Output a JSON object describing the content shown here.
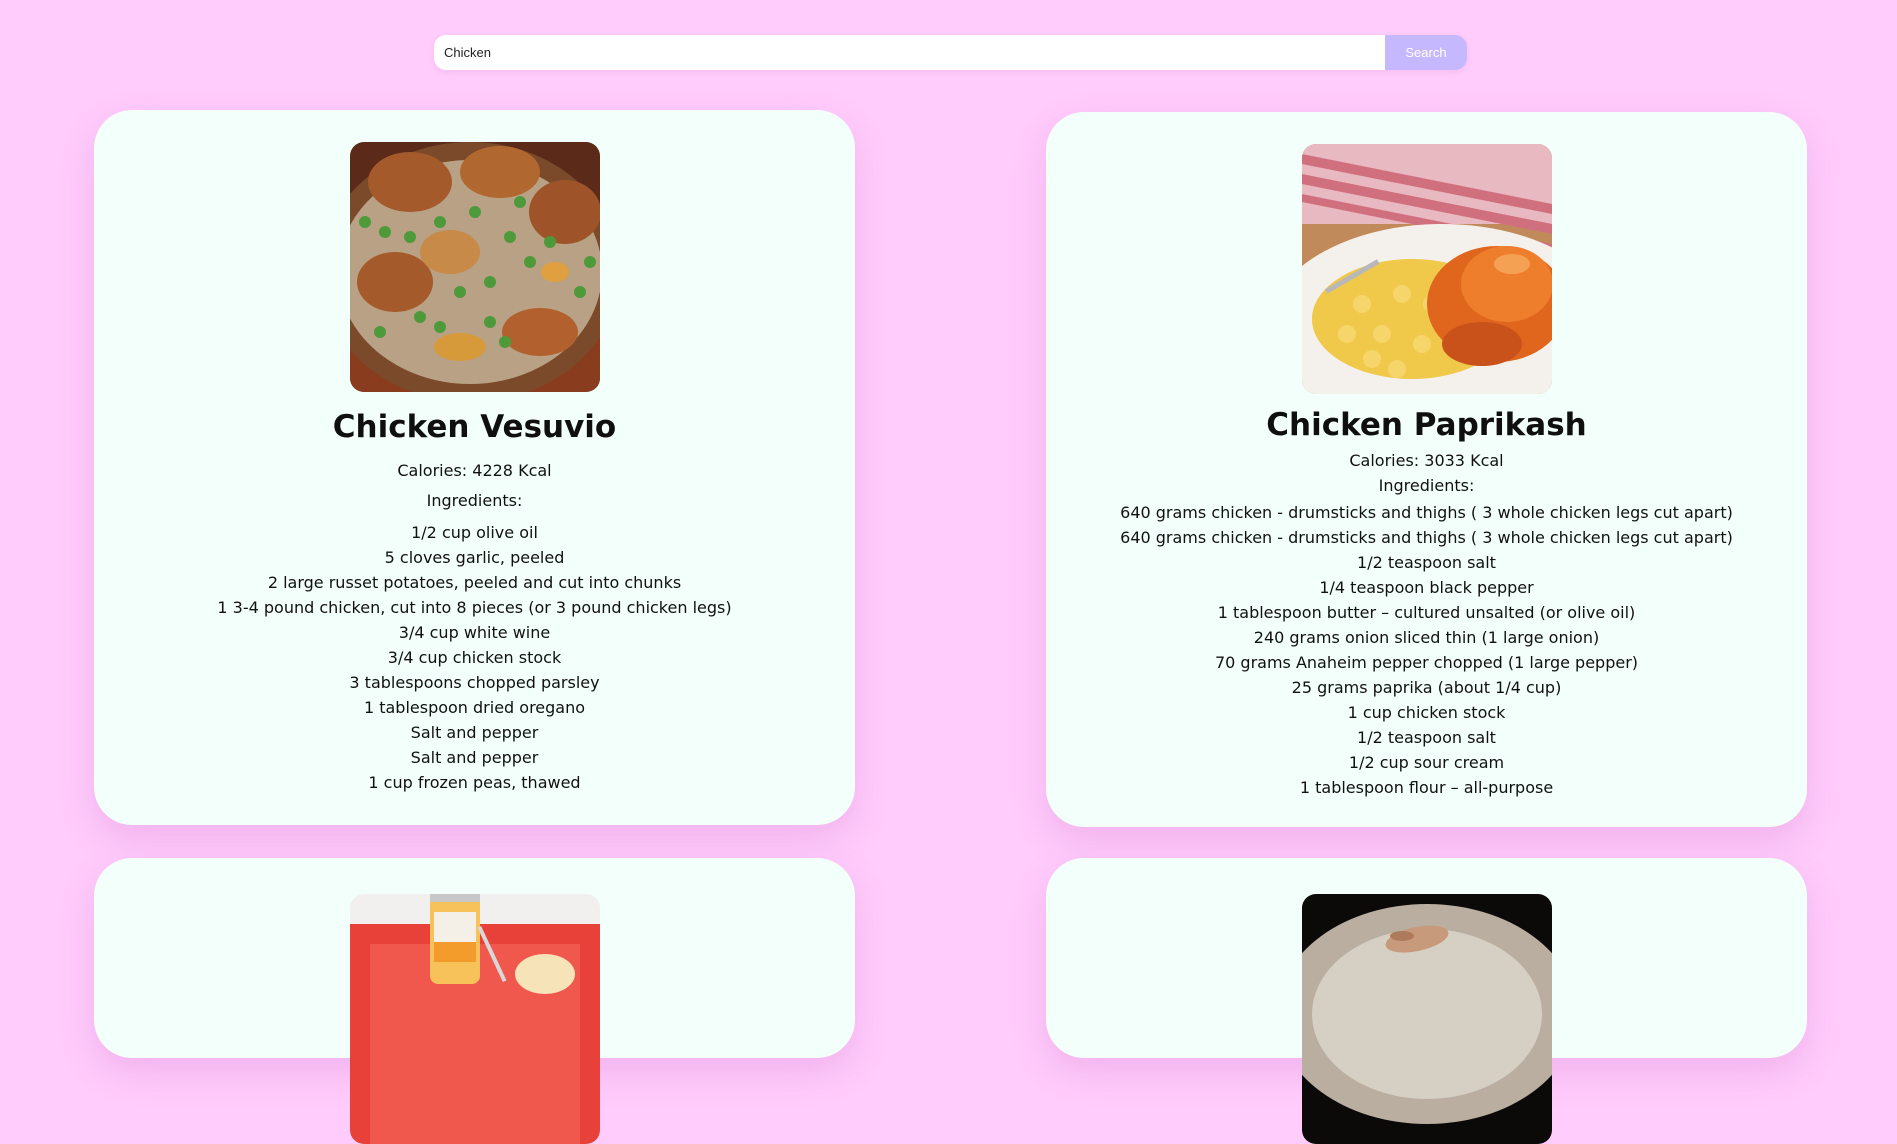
{
  "search": {
    "value": "Chicken",
    "button_label": "Search"
  },
  "recipes": [
    {
      "title": "Chicken Vesuvio",
      "calories": "Calories: 4228 Kcal",
      "ingredients_label": "Ingredients:",
      "ingredients": [
        "1/2 cup olive oil",
        "5 cloves garlic, peeled",
        "2 large russet potatoes, peeled and cut into chunks",
        "1 3-4 pound chicken, cut into 8 pieces (or 3 pound chicken legs)",
        "3/4 cup white wine",
        "3/4 cup chicken stock",
        "3 tablespoons chopped parsley",
        "1 tablespoon dried oregano",
        "Salt and pepper",
        "Salt and pepper",
        "1 cup frozen peas, thawed"
      ]
    },
    {
      "title": "Chicken Paprikash",
      "calories": "Calories: 3033 Kcal",
      "ingredients_label": "Ingredients:",
      "ingredients": [
        "640 grams chicken - drumsticks and thighs ( 3 whole chicken legs cut apart)",
        "640 grams chicken - drumsticks and thighs ( 3 whole chicken legs cut apart)",
        "1/2 teaspoon salt",
        "1/4 teaspoon black pepper",
        "1 tablespoon butter – cultured unsalted (or olive oil)",
        "240 grams onion sliced thin (1 large onion)",
        "70 grams Anaheim pepper chopped (1 large pepper)",
        "25 grams paprika (about 1/4 cup)",
        "1 cup chicken stock",
        "1/2 teaspoon salt",
        "1/2 cup sour cream",
        "1 tablespoon flour – all-purpose"
      ]
    }
  ],
  "colors": {
    "page_background": "#ffccfb",
    "card_background": "#f3fffb",
    "search_button": "#c6b8ff"
  }
}
